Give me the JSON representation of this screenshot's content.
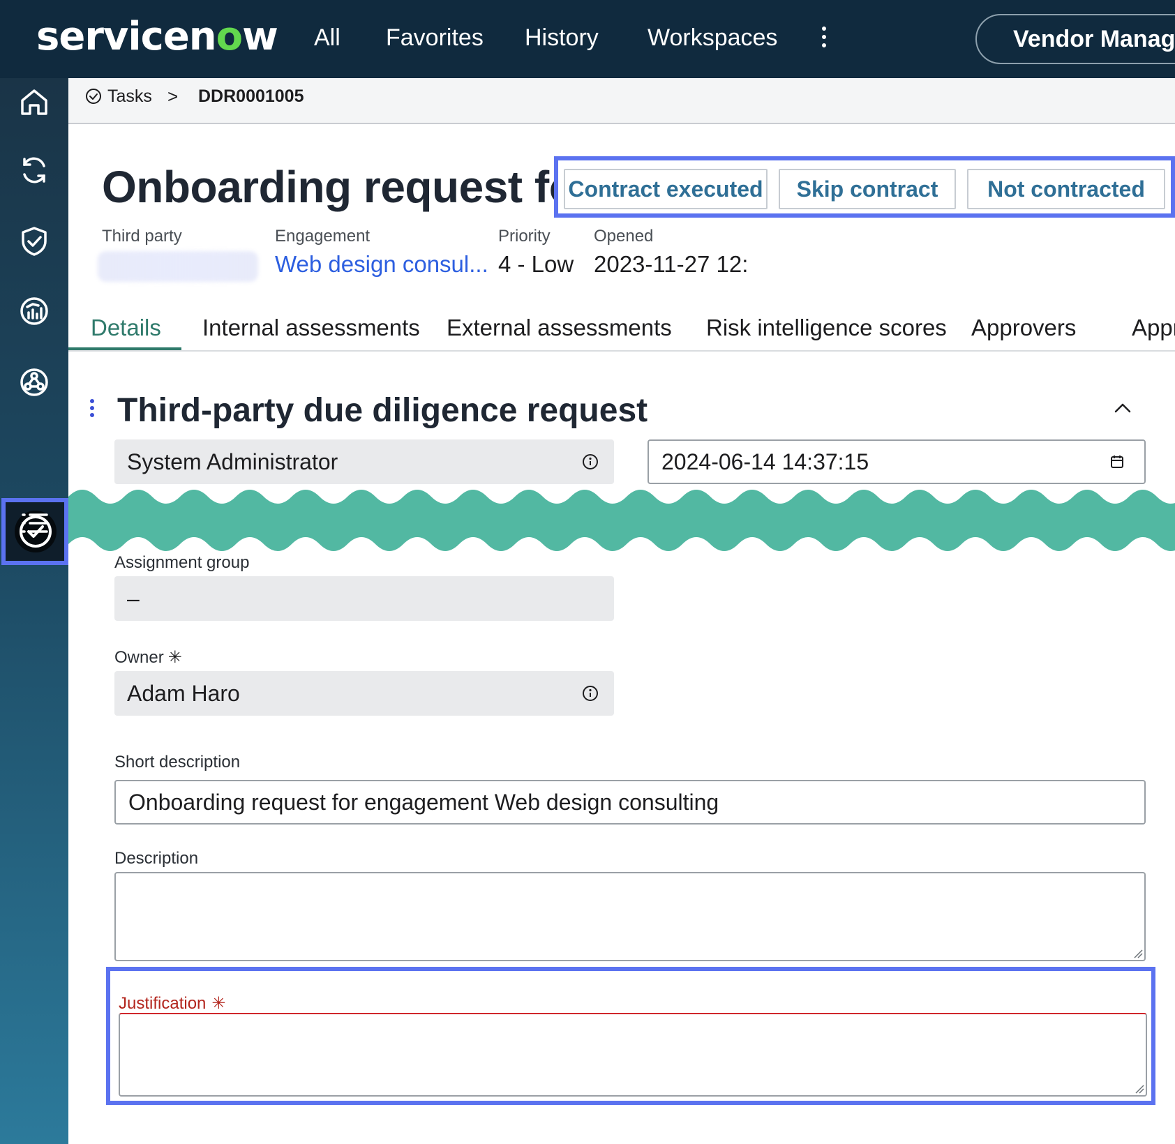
{
  "app": {
    "logo_text_a": "servicen",
    "logo_text_o": "o",
    "logo_text_b": "w",
    "brand_color": "#62d84e"
  },
  "topnav": {
    "items": [
      "All",
      "Favorites",
      "History",
      "Workspaces"
    ],
    "workspace_label": "Vendor Manage"
  },
  "sidebar": {
    "items": [
      {
        "icon": "home-icon"
      },
      {
        "icon": "refresh-icon"
      },
      {
        "icon": "shield-check-icon"
      },
      {
        "icon": "dashboard-gauge-icon"
      },
      {
        "icon": "network-icon"
      },
      {
        "icon": "tasks-check-icon",
        "active": true
      },
      {
        "icon": "list-icon"
      }
    ],
    "active_color": "#5b72f0"
  },
  "breadcrumb": {
    "tasks_label": "Tasks",
    "separator": ">",
    "record_id": "DDR0001005"
  },
  "header": {
    "title": "Onboarding request for",
    "actions": [
      "Contract executed",
      "Skip contract",
      "Not contracted"
    ]
  },
  "meta": {
    "third_party_label": "Third party",
    "engagement_label": "Engagement",
    "engagement_value": "Web design consul...",
    "priority_label": "Priority",
    "priority_value": "4 - Low",
    "opened_label": "Opened",
    "opened_value": "2023-11-27 12:"
  },
  "tabs": [
    "Details",
    "Internal assessments",
    "External assessments",
    "Risk intelligence scores",
    "Approvers",
    "Appr"
  ],
  "section": {
    "title": "Third-party due diligence request"
  },
  "form": {
    "requested_by_value": "System Administrator",
    "requested_date_value": "2024-06-14 14:37:15",
    "assignment_group_label": "Assignment group",
    "assignment_group_value": "–",
    "owner_label": "Owner",
    "owner_required_mark": "✳",
    "owner_value": "Adam Haro",
    "short_description_label": "Short description",
    "short_description_value": "Onboarding request for engagement Web design consulting",
    "description_label": "Description",
    "description_value": "",
    "justification_label": "Justification",
    "justification_required_mark": "✳",
    "justification_value": ""
  },
  "colors": {
    "topbar": "#102a3e",
    "highlight": "#5b72f0",
    "action_text": "#2f6f96",
    "tab_active": "#2f7a6b",
    "link": "#2d5fe0",
    "error": "#b3261e",
    "wave": "#52b8a2"
  }
}
